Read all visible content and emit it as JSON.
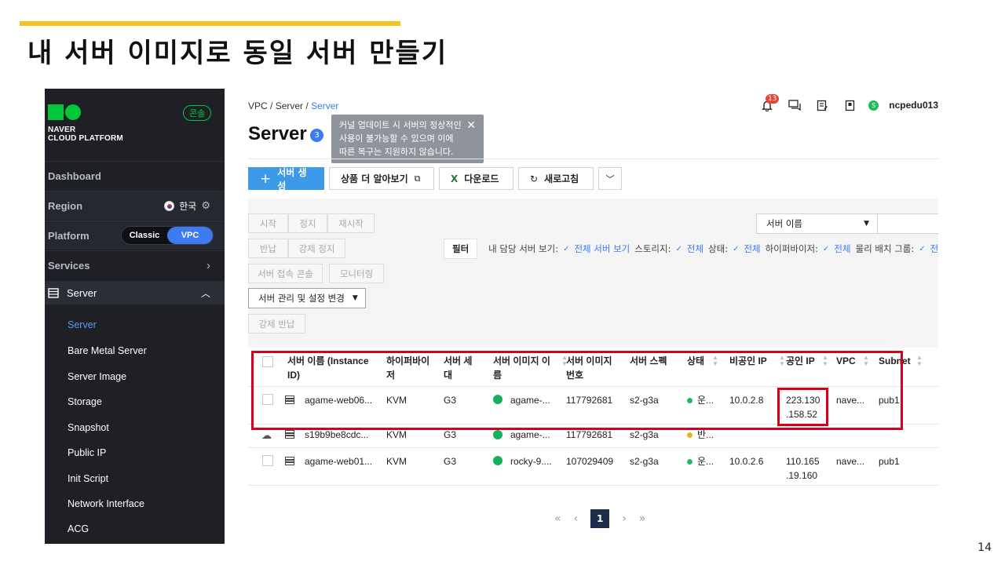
{
  "slide": {
    "title": "내 서버 이미지로 동일 서버 만들기",
    "page_number": "14"
  },
  "sidebar": {
    "logo_line1": "NAVER",
    "logo_line2": "CLOUD PLATFORM",
    "console_badge": "콘솔",
    "dashboard": "Dashboard",
    "region_label": "Region",
    "region_value": "한국",
    "platform_label": "Platform",
    "platform_classic": "Classic",
    "platform_vpc": "VPC",
    "services": "Services",
    "server": "Server",
    "items": [
      "Server",
      "Bare Metal Server",
      "Server Image",
      "Storage",
      "Snapshot",
      "Public IP",
      "Init Script",
      "Network Interface",
      "ACG"
    ]
  },
  "header": {
    "breadcrumb_1": "VPC",
    "breadcrumb_2": "Server",
    "breadcrumb_3": "Server",
    "title": "Server",
    "count": "3",
    "tooltip_line1": "커널 업데이트 시 서버의 정상적인",
    "tooltip_line2": "사용이 불가능할 수 있으며 이에",
    "tooltip_line3": "따른 복구는 지원하지 않습니다.",
    "notification_count": "13",
    "username": "ncpedu013",
    "user_initial": "S"
  },
  "toolbar": {
    "create": "서버 생성",
    "learn_more": "상품 더 알아보기",
    "download": "다운로드",
    "refresh": "새로고침"
  },
  "actions": {
    "start": "시작",
    "stop": "정지",
    "restart": "재시작",
    "return": "반납",
    "force_stop": "강제 정지",
    "console": "서버 접속 콘솔",
    "monitoring": "모니터링",
    "manage": "서버 관리 및 설정 변경",
    "force_return": "강제 반납"
  },
  "search": {
    "select_value": "서버 이름"
  },
  "filters": {
    "label": "필터",
    "my_servers_label": "내 담당 서버 보기:",
    "my_servers_value": "전체 서버 보기",
    "storage_label": "스토리지:",
    "storage_value": "전체",
    "status_label": "상태:",
    "status_value": "전체",
    "hypervisor_label": "하이퍼바이저:",
    "hypervisor_value": "전체",
    "placement_label": "물리 배치 그룹:",
    "placement_value": "전체"
  },
  "table": {
    "headers": {
      "name_1": "서버 이름 (Instance",
      "name_2": "ID)",
      "hyper_1": "하이퍼바이",
      "hyper_2": "저",
      "gen_1": "서버 세",
      "gen_2": "대",
      "image_1": "서버 이미지 이",
      "image_2": "름",
      "imgno_1": "서버 이미지",
      "imgno_2": "번호",
      "spec": "서버 스펙",
      "status": "상태",
      "private_ip": "비공인 IP",
      "public_ip": "공인 IP",
      "vpc": "VPC",
      "subnet": "Subnet"
    },
    "rows": [
      {
        "name": "agame-web06...",
        "hyper": "KVM",
        "gen": "G3",
        "image": "agame-...",
        "imgno": "117792681",
        "spec": "s2-g3a",
        "status": "운...",
        "status_color": "#1ebd5a",
        "private_ip": "10.0.2.8",
        "public_ip_1": "223.130",
        "public_ip_2": ".158.52",
        "vpc": "nave...",
        "subnet": "pub1"
      },
      {
        "name": "s19b9be8cdc...",
        "hyper": "KVM",
        "gen": "G3",
        "image": "agame-...",
        "imgno": "117792681",
        "spec": "s2-g3a",
        "status": "반...",
        "status_color": "#e8b21f",
        "private_ip": "",
        "public_ip_1": "",
        "public_ip_2": "",
        "vpc": "",
        "subnet": ""
      },
      {
        "name": "agame-web01...",
        "hyper": "KVM",
        "gen": "G3",
        "image": "rocky-9....",
        "imgno": "107029409",
        "spec": "s2-g3a",
        "status": "운...",
        "status_color": "#1ebd5a",
        "private_ip": "10.0.2.6",
        "public_ip_1": "110.165",
        "public_ip_2": ".19.160",
        "vpc": "nave...",
        "subnet": "pub1"
      }
    ]
  },
  "pagination": {
    "current": "1"
  }
}
